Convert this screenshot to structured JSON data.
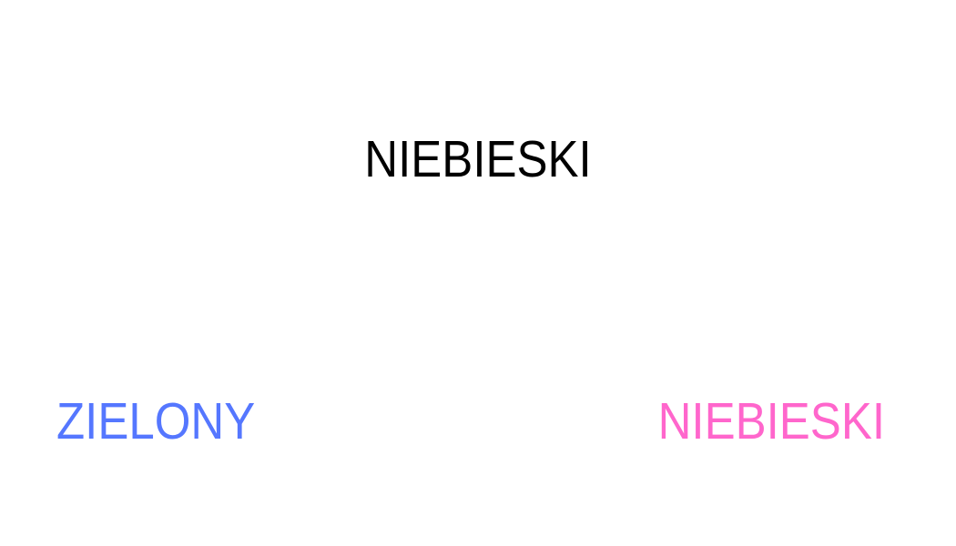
{
  "prompt": {
    "text": "NIEBIESKI",
    "color": "#000000"
  },
  "options": [
    {
      "text": "ZIELONY",
      "color": "#5577ff"
    },
    {
      "text": "NIEBIESKI",
      "color": "#ff66cc"
    }
  ]
}
